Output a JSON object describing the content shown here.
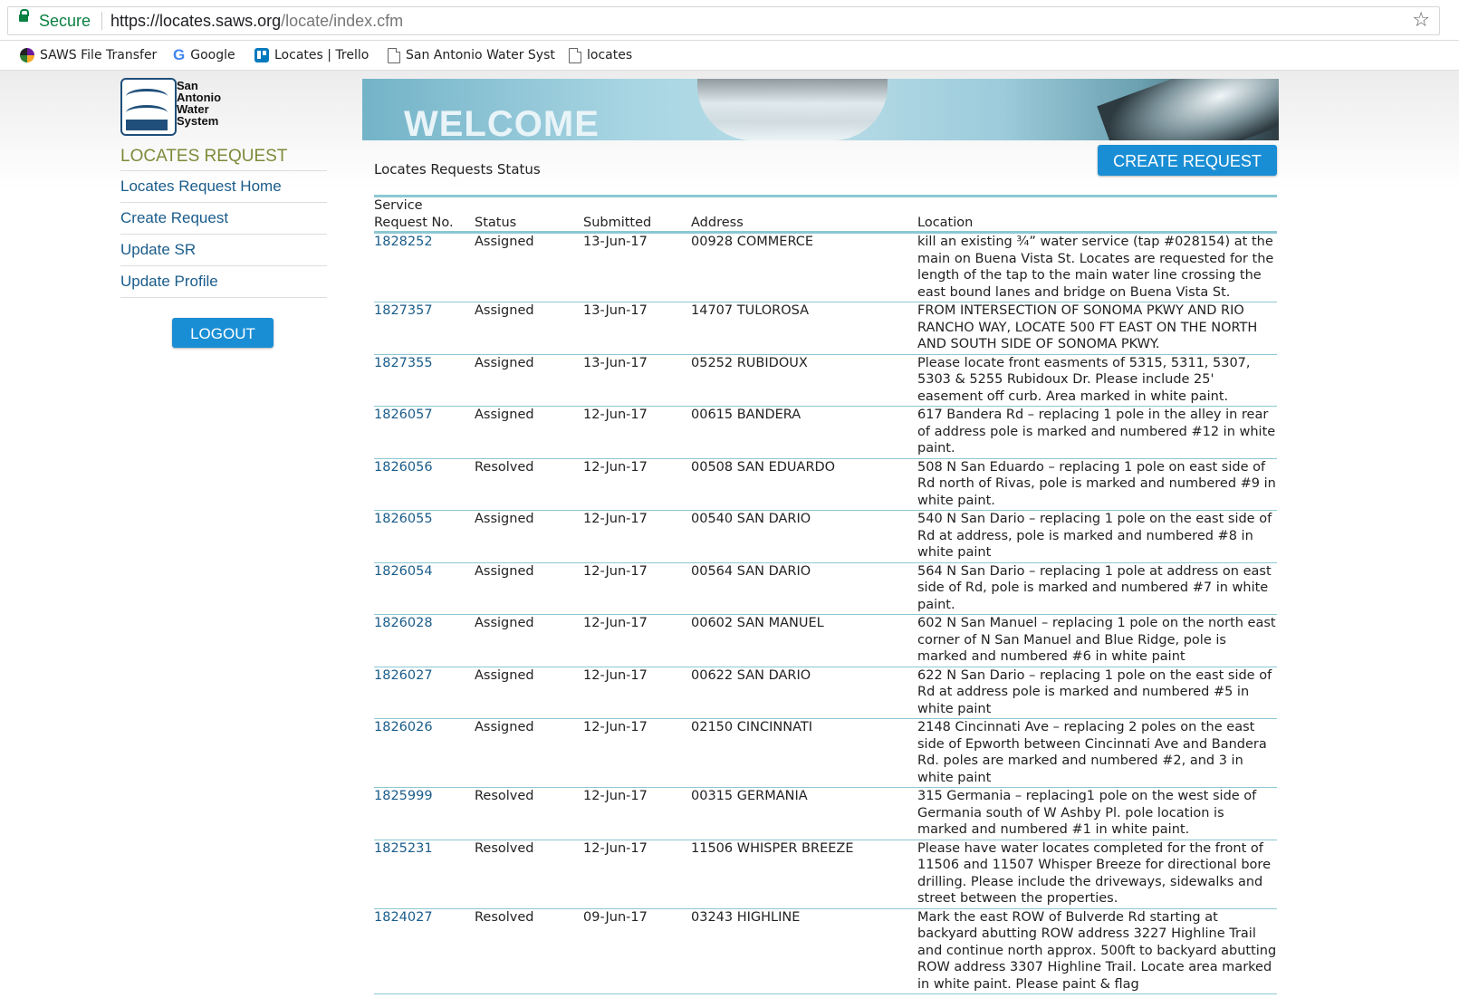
{
  "browser": {
    "secure_label": "Secure",
    "url_host": "https://locates.saws.org",
    "url_path": "/locate/index.cfm",
    "bookmarks": [
      {
        "label": "SAWS File Transfer",
        "icon": "saws-icon"
      },
      {
        "label": "Google",
        "icon": "google-icon"
      },
      {
        "label": "Locates | Trello",
        "icon": "trello-icon"
      },
      {
        "label": "San Antonio Water Syst",
        "icon": "page-icon"
      },
      {
        "label": "locates",
        "icon": "page-icon"
      }
    ]
  },
  "logo": {
    "line1": "San",
    "line2": "Antonio",
    "line3": "Water",
    "line4": "System"
  },
  "sidebar": {
    "title": "LOCATES REQUEST",
    "items": [
      {
        "label": "Locates Request Home"
      },
      {
        "label": "Create Request"
      },
      {
        "label": "Update SR"
      },
      {
        "label": "Update Profile"
      }
    ],
    "logout_label": "LOGOUT"
  },
  "banner": {
    "text": "WELCOME"
  },
  "main": {
    "create_button": "CREATE REQUEST",
    "status_title": "Locates Requests Status",
    "columns": [
      "Service Request No.",
      "Status",
      "Submitted",
      "Address",
      "Location"
    ],
    "rows": [
      {
        "sr": "1828252",
        "status": "Assigned",
        "submitted": "13-Jun-17",
        "address": "00928 COMMERCE",
        "location": "kill an existing ¾” water service (tap #028154) at the main on Buena Vista St. Locates are requested for the length of the tap to the main water line crossing the east bound lanes and bridge on Buena Vista St."
      },
      {
        "sr": "1827357",
        "status": "Assigned",
        "submitted": "13-Jun-17",
        "address": "14707 TULOROSA",
        "location": "FROM INTERSECTION OF SONOMA PKWY AND RIO RANCHO WAY, LOCATE 500 FT EAST ON THE NORTH AND SOUTH SIDE OF SONOMA PKWY."
      },
      {
        "sr": "1827355",
        "status": "Assigned",
        "submitted": "13-Jun-17",
        "address": "05252 RUBIDOUX",
        "location": "Please locate front easments of 5315, 5311, 5307, 5303 & 5255 Rubidoux Dr. Please include 25' easement off curb. Area marked in white paint."
      },
      {
        "sr": "1826057",
        "status": "Assigned",
        "submitted": "12-Jun-17",
        "address": "00615 BANDERA",
        "location": "617 Bandera Rd – replacing 1 pole in the alley in rear of address pole is marked and numbered #12 in white paint."
      },
      {
        "sr": "1826056",
        "status": "Resolved",
        "submitted": "12-Jun-17",
        "address": "00508 SAN EDUARDO",
        "location": "508 N San Eduardo – replacing 1 pole on east side of Rd north of Rivas, pole is marked and numbered #9 in white paint."
      },
      {
        "sr": "1826055",
        "status": "Assigned",
        "submitted": "12-Jun-17",
        "address": "00540 SAN DARIO",
        "location": "540 N San Dario – replacing 1 pole on the east side of Rd at address, pole is marked and numbered #8 in white paint"
      },
      {
        "sr": "1826054",
        "status": "Assigned",
        "submitted": "12-Jun-17",
        "address": "00564 SAN DARIO",
        "location": "564 N San Dario – replacing 1 pole at address on east side of Rd, pole is marked and numbered #7 in white paint."
      },
      {
        "sr": "1826028",
        "status": "Assigned",
        "submitted": "12-Jun-17",
        "address": "00602 SAN MANUEL",
        "location": "602 N San Manuel – replacing 1 pole on the north east corner of N San Manuel and Blue Ridge, pole is marked and numbered #6 in white paint"
      },
      {
        "sr": "1826027",
        "status": "Assigned",
        "submitted": "12-Jun-17",
        "address": "00622 SAN DARIO",
        "location": "622 N San Dario – replacing 1 pole on the east side of Rd at address pole is marked and numbered #5 in white paint"
      },
      {
        "sr": "1826026",
        "status": "Assigned",
        "submitted": "12-Jun-17",
        "address": "02150 CINCINNATI",
        "location": "2148 Cincinnati Ave – replacing 2 poles on the east side of Epworth between Cincinnati Ave and Bandera Rd. poles are marked and numbered #2, and 3 in white paint"
      },
      {
        "sr": "1825999",
        "status": "Resolved",
        "submitted": "12-Jun-17",
        "address": "00315 GERMANIA",
        "location": "315 Germania – replacing1 pole on the west side of Germania south of W Ashby Pl. pole location is marked and numbered #1 in white paint."
      },
      {
        "sr": "1825231",
        "status": "Resolved",
        "submitted": "12-Jun-17",
        "address": "11506 WHISPER BREEZE",
        "location": "Please have water locates completed for the front of 11506 and 11507 Whisper Breeze for directional bore drilling. Please include the driveways, sidewalks and street between the properties."
      },
      {
        "sr": "1824027",
        "status": "Resolved",
        "submitted": "09-Jun-17",
        "address": "03243 HIGHLINE",
        "location": "Mark the east ROW of Bulverde Rd starting at backyard abutting ROW address 3227 Highline Trail and continue north approx. 500ft to backyard abutting ROW address 3307 Highline Trail. Locate area marked in white paint. Please paint & flag"
      }
    ]
  },
  "colors": {
    "accent": "#1a8ed4",
    "link": "#1a5c8a",
    "sidebar_title": "#7f8a3a",
    "table_rule": "#8cc8d4"
  }
}
